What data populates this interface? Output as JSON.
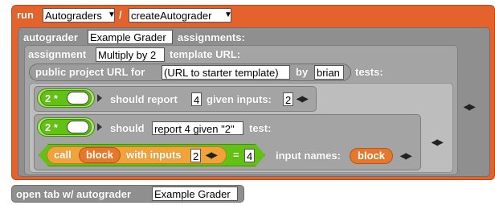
{
  "header": {
    "run": "run",
    "library": "Autograders",
    "sep": "/",
    "command": "createAutograder"
  },
  "autograder": {
    "label": "autograder",
    "name": "Example Grader",
    "assignments_label": "assignments:"
  },
  "assignment": {
    "label": "assignment",
    "name": "Multiply by 2",
    "template_label": "template URL:"
  },
  "public_url": {
    "prefix": "public project URL for",
    "value": "(URL to starter template)",
    "by": "by",
    "user": "brian",
    "tests": "tests:"
  },
  "test1": {
    "expr": "2 *",
    "should": "should report",
    "value": "4",
    "given": "given inputs:",
    "input": "2"
  },
  "test2": {
    "expr": "2 *",
    "should": "should",
    "value": "report 4 given \"2\"",
    "test": "test:"
  },
  "call": {
    "call": "call",
    "block": "block",
    "with_inputs": "with inputs",
    "input": "2",
    "eq": "=",
    "result": "4",
    "input_names": "input names:",
    "input_name": "block"
  },
  "footer": {
    "open_tab": "open tab w/ autograder",
    "name": "Example Grader"
  },
  "colors": {
    "orange": "#e4622b",
    "green": "#62c213",
    "grey": "#9c9c9c"
  }
}
